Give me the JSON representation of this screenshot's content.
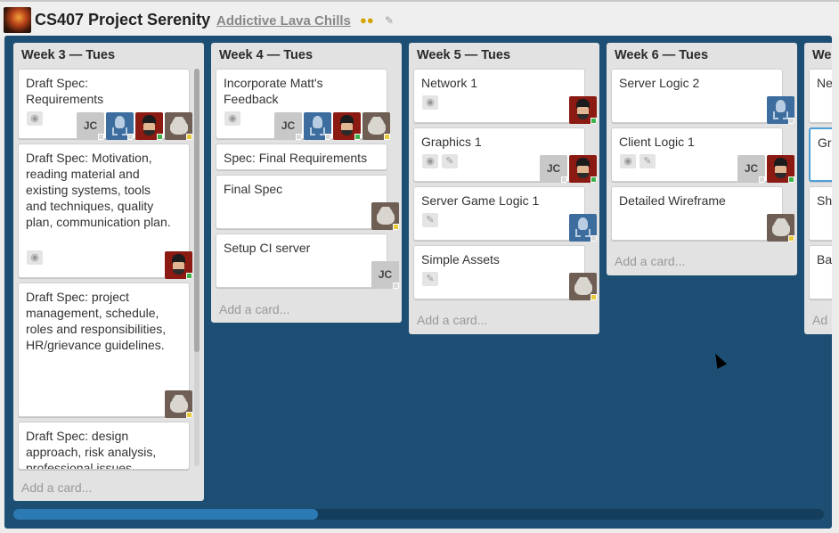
{
  "header": {
    "board_title": "CS407 Project Serenity",
    "org_name": "Addictive Lava Chills",
    "org_icon": "people-icon",
    "edit_icon": "pencil-icon"
  },
  "colors": {
    "board_bg": "#1c4f73",
    "list_bg": "#e2e2e2",
    "status_green": "#3cb34a",
    "status_yellow": "#e8c93a",
    "status_gray": "#d9d9d9"
  },
  "lists": [
    {
      "title": "Week 3 — Tues",
      "add_label": "Add a card...",
      "cards": [
        {
          "title": "Draft Spec: Requirements"
        },
        {
          "title": "Draft Spec: Motivation, reading material and existing systems, tools and techniques, quality plan, communication plan."
        },
        {
          "title": "Draft Spec: project management, schedule, roles and responsibilities, HR/grievance guidelines."
        },
        {
          "title": "Draft Spec: design approach, risk analysis, professional issues."
        }
      ]
    },
    {
      "title": "Week 4 — Tues",
      "add_label": "Add a card...",
      "cards": [
        {
          "title": "Incorporate Matt's Feedback"
        },
        {
          "title": "Spec: Final Requirements"
        },
        {
          "title": "Final Spec"
        },
        {
          "title": "Setup CI server"
        }
      ]
    },
    {
      "title": "Week 5 — Tues",
      "add_label": "Add a card...",
      "cards": [
        {
          "title": "Network 1"
        },
        {
          "title": "Graphics 1"
        },
        {
          "title": "Server Game Logic 1"
        },
        {
          "title": "Simple Assets"
        }
      ]
    },
    {
      "title": "Week 6 — Tues",
      "add_label": "Add a card...",
      "cards": [
        {
          "title": "Server Logic 2"
        },
        {
          "title": "Client Logic 1"
        },
        {
          "title": "Detailed Wireframe"
        }
      ]
    },
    {
      "title": "We",
      "add_label": "Ad",
      "cards": [
        {
          "title": "Ne"
        },
        {
          "title": "Gr"
        },
        {
          "title": "Sh"
        },
        {
          "title": "Ba"
        }
      ]
    }
  ],
  "member_initials": "JC"
}
